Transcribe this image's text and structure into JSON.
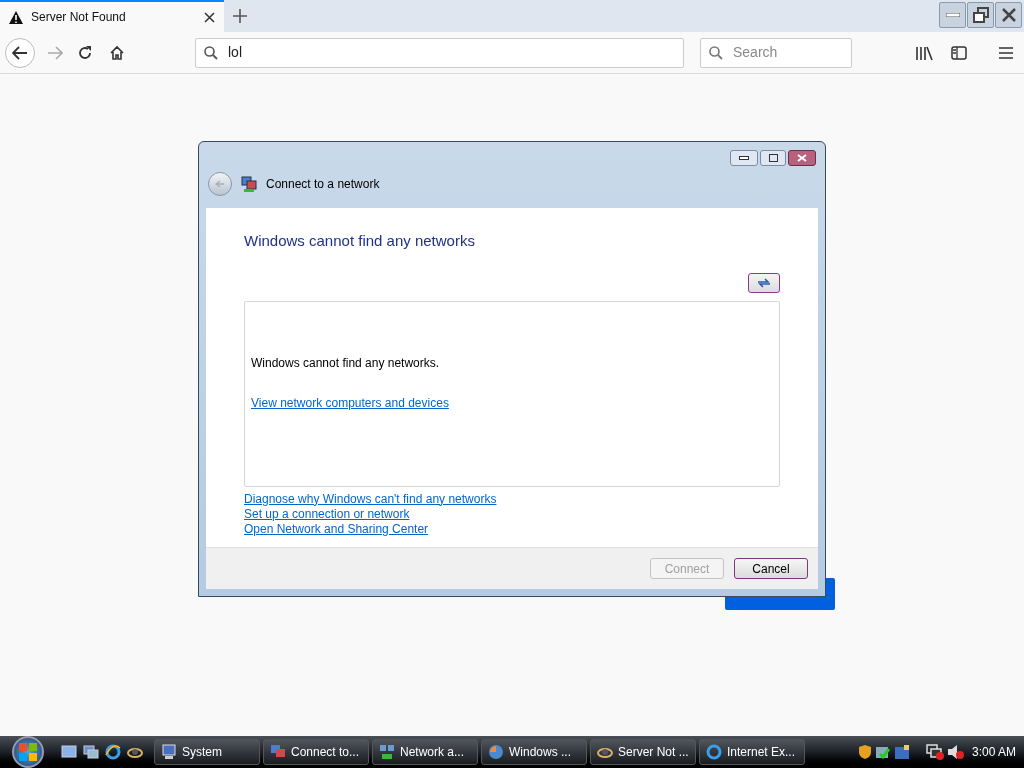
{
  "browser": {
    "tabs": [
      {
        "title": "Server Not Found",
        "selected": true
      }
    ],
    "address": "lol",
    "search": {
      "placeholder": "Search"
    }
  },
  "dialog": {
    "title": "Connect to a network",
    "heading": "Windows cannot find any networks",
    "message": "Windows cannot find any networks.",
    "list_link": "View network computers and devices",
    "links": [
      "Diagnose why Windows can't find any networks",
      "Set up a connection or network",
      "Open Network and Sharing Center"
    ],
    "buttons": [
      {
        "label": "Connect",
        "disabled": true
      },
      {
        "label": "Cancel",
        "disabled": false
      }
    ]
  },
  "taskbar": {
    "items": [
      {
        "label": "System"
      },
      {
        "label": "Connect to..."
      },
      {
        "label": "Network a..."
      },
      {
        "label": "Windows ..."
      },
      {
        "label": "Server Not ..."
      },
      {
        "label": "Internet Ex..."
      }
    ],
    "clock": "3:00 AM"
  }
}
